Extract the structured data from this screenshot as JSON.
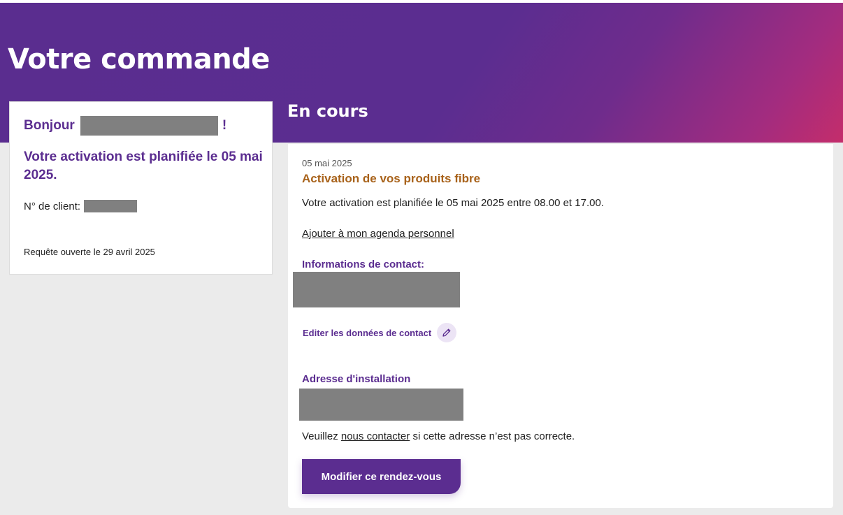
{
  "header": {
    "title": "Votre commande",
    "status_title": "En cours"
  },
  "summary": {
    "greeting": "Bonjour",
    "greeting_suffix": "!",
    "activation_heading": "Votre activation est planifiée le 05 mai 2025.",
    "client_label": "N° de client:",
    "request_opened": "Requête ouverte le 29 avril 2025"
  },
  "order": {
    "date": "05 mai 2025",
    "title": "Activation de vos produits fibre",
    "activation_text": "Votre activation est planifiée le 05 mai 2025 entre 08.00 et 17.00.",
    "agenda_link": "Ajouter à mon agenda personnel",
    "contact_heading": "Informations de contact:",
    "edit_contact_label": "Editer les données de contact",
    "edit_icon": "pencil-icon",
    "address_heading": "Adresse d'installation",
    "address_note_before": "Veuillez ",
    "address_note_link": "nous contacter",
    "address_note_after": " si cette adresse n’est pas correcte.",
    "modify_button": "Modifier ce rendez-vous"
  },
  "colors": {
    "brand_purple": "#5b2d90",
    "accent_orange": "#a8621a",
    "gradient_end": "#c42d6b",
    "redaction_gray": "#808080"
  }
}
